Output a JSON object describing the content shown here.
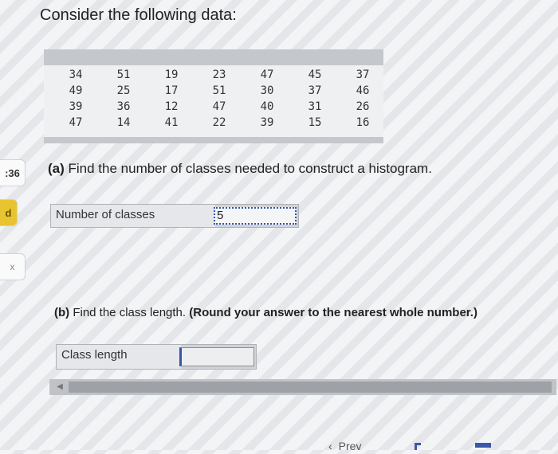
{
  "sidebar": {
    "timer_label": ":36",
    "flag_label": "d",
    "close_label": "x"
  },
  "heading": "Consider the following data:",
  "data_table": {
    "rows": [
      [
        "34",
        "51",
        "19",
        "23",
        "47",
        "45",
        "37"
      ],
      [
        "49",
        "25",
        "17",
        "51",
        "30",
        "37",
        "46"
      ],
      [
        "39",
        "36",
        "12",
        "47",
        "40",
        "31",
        "26"
      ],
      [
        "47",
        "14",
        "41",
        "22",
        "39",
        "15",
        "16"
      ]
    ]
  },
  "part_a": {
    "letter": "(a)",
    "text": " Find the number of classes needed to construct a histogram.",
    "label": "Number of classes",
    "value": "5"
  },
  "part_b": {
    "letter": "(b)",
    "text": " Find the class length. ",
    "bold_text": "(Round your answer to the nearest whole number.)",
    "label": "Class length",
    "value": ""
  },
  "navigation": {
    "prev_label": "Prev"
  }
}
